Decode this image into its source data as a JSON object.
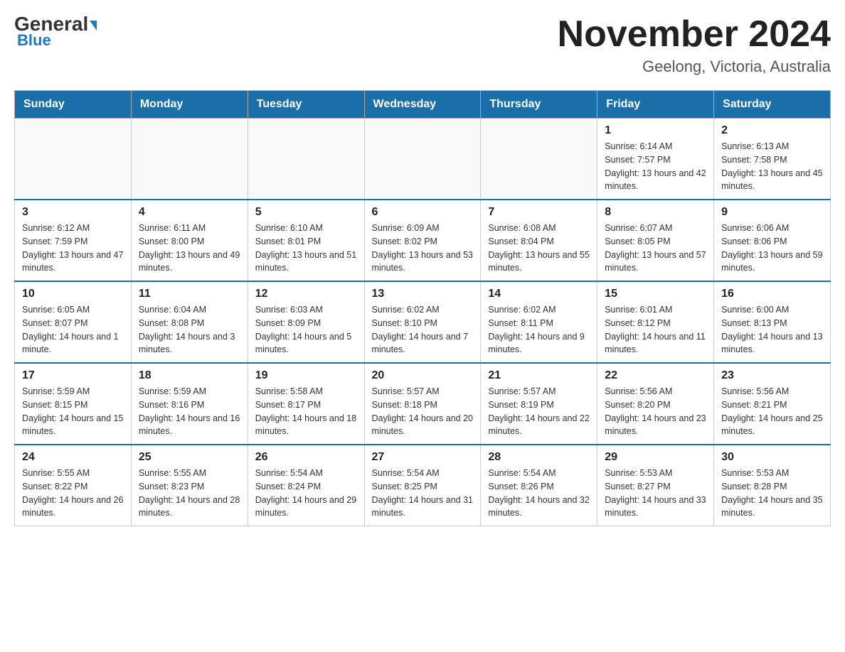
{
  "header": {
    "logo_general": "General",
    "logo_blue": "Blue",
    "title": "November 2024",
    "subtitle": "Geelong, Victoria, Australia"
  },
  "days_of_week": [
    "Sunday",
    "Monday",
    "Tuesday",
    "Wednesday",
    "Thursday",
    "Friday",
    "Saturday"
  ],
  "weeks": [
    {
      "days": [
        {
          "num": "",
          "info": ""
        },
        {
          "num": "",
          "info": ""
        },
        {
          "num": "",
          "info": ""
        },
        {
          "num": "",
          "info": ""
        },
        {
          "num": "",
          "info": ""
        },
        {
          "num": "1",
          "info": "Sunrise: 6:14 AM\nSunset: 7:57 PM\nDaylight: 13 hours and 42 minutes."
        },
        {
          "num": "2",
          "info": "Sunrise: 6:13 AM\nSunset: 7:58 PM\nDaylight: 13 hours and 45 minutes."
        }
      ]
    },
    {
      "days": [
        {
          "num": "3",
          "info": "Sunrise: 6:12 AM\nSunset: 7:59 PM\nDaylight: 13 hours and 47 minutes."
        },
        {
          "num": "4",
          "info": "Sunrise: 6:11 AM\nSunset: 8:00 PM\nDaylight: 13 hours and 49 minutes."
        },
        {
          "num": "5",
          "info": "Sunrise: 6:10 AM\nSunset: 8:01 PM\nDaylight: 13 hours and 51 minutes."
        },
        {
          "num": "6",
          "info": "Sunrise: 6:09 AM\nSunset: 8:02 PM\nDaylight: 13 hours and 53 minutes."
        },
        {
          "num": "7",
          "info": "Sunrise: 6:08 AM\nSunset: 8:04 PM\nDaylight: 13 hours and 55 minutes."
        },
        {
          "num": "8",
          "info": "Sunrise: 6:07 AM\nSunset: 8:05 PM\nDaylight: 13 hours and 57 minutes."
        },
        {
          "num": "9",
          "info": "Sunrise: 6:06 AM\nSunset: 8:06 PM\nDaylight: 13 hours and 59 minutes."
        }
      ]
    },
    {
      "days": [
        {
          "num": "10",
          "info": "Sunrise: 6:05 AM\nSunset: 8:07 PM\nDaylight: 14 hours and 1 minute."
        },
        {
          "num": "11",
          "info": "Sunrise: 6:04 AM\nSunset: 8:08 PM\nDaylight: 14 hours and 3 minutes."
        },
        {
          "num": "12",
          "info": "Sunrise: 6:03 AM\nSunset: 8:09 PM\nDaylight: 14 hours and 5 minutes."
        },
        {
          "num": "13",
          "info": "Sunrise: 6:02 AM\nSunset: 8:10 PM\nDaylight: 14 hours and 7 minutes."
        },
        {
          "num": "14",
          "info": "Sunrise: 6:02 AM\nSunset: 8:11 PM\nDaylight: 14 hours and 9 minutes."
        },
        {
          "num": "15",
          "info": "Sunrise: 6:01 AM\nSunset: 8:12 PM\nDaylight: 14 hours and 11 minutes."
        },
        {
          "num": "16",
          "info": "Sunrise: 6:00 AM\nSunset: 8:13 PM\nDaylight: 14 hours and 13 minutes."
        }
      ]
    },
    {
      "days": [
        {
          "num": "17",
          "info": "Sunrise: 5:59 AM\nSunset: 8:15 PM\nDaylight: 14 hours and 15 minutes."
        },
        {
          "num": "18",
          "info": "Sunrise: 5:59 AM\nSunset: 8:16 PM\nDaylight: 14 hours and 16 minutes."
        },
        {
          "num": "19",
          "info": "Sunrise: 5:58 AM\nSunset: 8:17 PM\nDaylight: 14 hours and 18 minutes."
        },
        {
          "num": "20",
          "info": "Sunrise: 5:57 AM\nSunset: 8:18 PM\nDaylight: 14 hours and 20 minutes."
        },
        {
          "num": "21",
          "info": "Sunrise: 5:57 AM\nSunset: 8:19 PM\nDaylight: 14 hours and 22 minutes."
        },
        {
          "num": "22",
          "info": "Sunrise: 5:56 AM\nSunset: 8:20 PM\nDaylight: 14 hours and 23 minutes."
        },
        {
          "num": "23",
          "info": "Sunrise: 5:56 AM\nSunset: 8:21 PM\nDaylight: 14 hours and 25 minutes."
        }
      ]
    },
    {
      "days": [
        {
          "num": "24",
          "info": "Sunrise: 5:55 AM\nSunset: 8:22 PM\nDaylight: 14 hours and 26 minutes."
        },
        {
          "num": "25",
          "info": "Sunrise: 5:55 AM\nSunset: 8:23 PM\nDaylight: 14 hours and 28 minutes."
        },
        {
          "num": "26",
          "info": "Sunrise: 5:54 AM\nSunset: 8:24 PM\nDaylight: 14 hours and 29 minutes."
        },
        {
          "num": "27",
          "info": "Sunrise: 5:54 AM\nSunset: 8:25 PM\nDaylight: 14 hours and 31 minutes."
        },
        {
          "num": "28",
          "info": "Sunrise: 5:54 AM\nSunset: 8:26 PM\nDaylight: 14 hours and 32 minutes."
        },
        {
          "num": "29",
          "info": "Sunrise: 5:53 AM\nSunset: 8:27 PM\nDaylight: 14 hours and 33 minutes."
        },
        {
          "num": "30",
          "info": "Sunrise: 5:53 AM\nSunset: 8:28 PM\nDaylight: 14 hours and 35 minutes."
        }
      ]
    }
  ]
}
